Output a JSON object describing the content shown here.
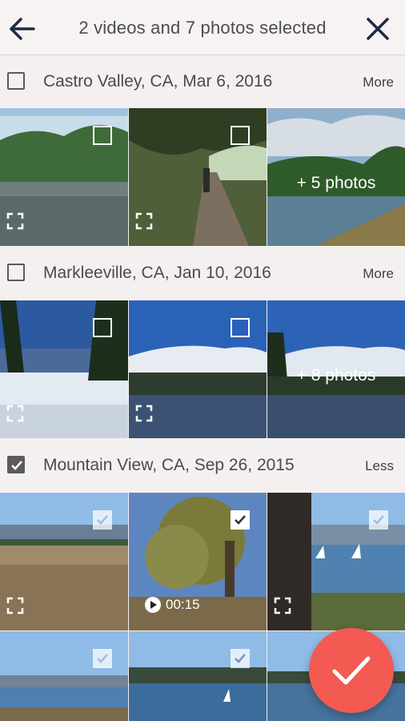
{
  "header": {
    "title": "2 videos and 7 photos selected",
    "back_icon": "arrow-left-icon",
    "close_icon": "close-icon"
  },
  "sections": [
    {
      "location": "Castro Valley, CA, Mar 6, 2016",
      "toggle_label": "More",
      "checked": false,
      "tiles": [
        {
          "selected": false,
          "overlay": ""
        },
        {
          "selected": false,
          "overlay": ""
        },
        {
          "selected": false,
          "overlay": "+ 5 photos"
        }
      ]
    },
    {
      "location": "Markleeville, CA, Jan 10, 2016",
      "toggle_label": "More",
      "checked": false,
      "tiles": [
        {
          "selected": false,
          "overlay": ""
        },
        {
          "selected": false,
          "overlay": ""
        },
        {
          "selected": false,
          "overlay": "+ 8 photos"
        }
      ]
    },
    {
      "location": "Mountain View, CA, Sep 26, 2015",
      "toggle_label": "Less",
      "checked": true,
      "tiles": [
        {
          "selected": true,
          "overlay": ""
        },
        {
          "selected": true,
          "overlay": "",
          "video_duration": "00:15"
        },
        {
          "selected": true,
          "overlay": ""
        },
        {
          "selected": true,
          "overlay": ""
        },
        {
          "selected": true,
          "overlay": ""
        },
        {
          "selected": false,
          "overlay": ""
        }
      ]
    }
  ],
  "fab": {
    "icon": "checkmark-icon",
    "color": "#f25a52"
  }
}
